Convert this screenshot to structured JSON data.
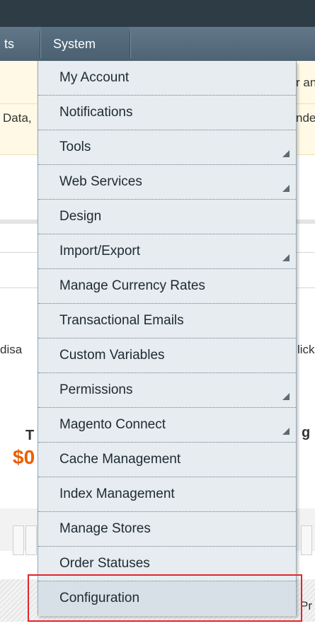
{
  "nav": {
    "partial_item": "ts",
    "system_label": "System"
  },
  "background": {
    "notice_right_1": "r an",
    "notice_left_2": "Data,",
    "notice_right_2": "nde",
    "disa_text": "disa",
    "lick_text": "lick",
    "t_text": "T",
    "price_text": "$0",
    "g_text": "g",
    "pr_text": "Pr"
  },
  "menu": {
    "items": [
      {
        "label": "My Account",
        "has_submenu": false
      },
      {
        "label": "Notifications",
        "has_submenu": false
      },
      {
        "label": "Tools",
        "has_submenu": true
      },
      {
        "label": "Web Services",
        "has_submenu": true
      },
      {
        "label": "Design",
        "has_submenu": false
      },
      {
        "label": "Import/Export",
        "has_submenu": true
      },
      {
        "label": "Manage Currency Rates",
        "has_submenu": false
      },
      {
        "label": "Transactional Emails",
        "has_submenu": false
      },
      {
        "label": "Custom Variables",
        "has_submenu": false
      },
      {
        "label": "Permissions",
        "has_submenu": true
      },
      {
        "label": "Magento Connect",
        "has_submenu": true
      },
      {
        "label": "Cache Management",
        "has_submenu": false
      },
      {
        "label": "Index Management",
        "has_submenu": false
      },
      {
        "label": "Manage Stores",
        "has_submenu": false
      },
      {
        "label": "Order Statuses",
        "has_submenu": false
      },
      {
        "label": "Configuration",
        "has_submenu": false
      }
    ]
  },
  "colors": {
    "highlight_border": "#e2242b",
    "price_orange": "#eb5e00",
    "menu_bg": "#e6ecef"
  }
}
